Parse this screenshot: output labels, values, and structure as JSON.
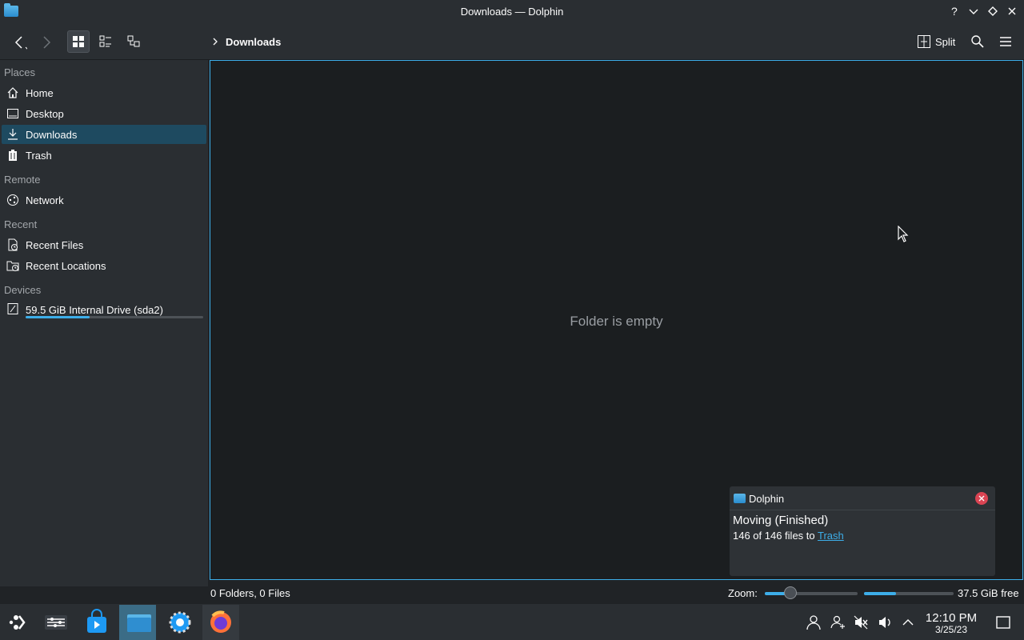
{
  "window": {
    "title": "Downloads — Dolphin"
  },
  "toolbar": {
    "breadcrumb": "Downloads",
    "split_label": "Split"
  },
  "sidebar": {
    "sections": {
      "places": "Places",
      "remote": "Remote",
      "recent": "Recent",
      "devices": "Devices"
    },
    "items": {
      "home": "Home",
      "desktop": "Desktop",
      "downloads": "Downloads",
      "trash": "Trash",
      "network": "Network",
      "recent_files": "Recent Files",
      "recent_locations": "Recent Locations",
      "drive": "59.5 GiB Internal Drive (sda2)"
    },
    "drive_usage_fraction": 0.36
  },
  "main": {
    "empty_text": "Folder is empty"
  },
  "statusbar": {
    "summary": "0 Folders, 0 Files",
    "zoom_label": "Zoom:",
    "free_space": "37.5 GiB free"
  },
  "notification": {
    "app": "Dolphin",
    "title": "Moving (Finished)",
    "body_prefix": "146 of 146 files to ",
    "link": "Trash"
  },
  "clock": {
    "time": "12:10 PM",
    "date": "3/25/23"
  },
  "colors": {
    "accent": "#3daee9",
    "selection": "#1e4a60",
    "close": "#da4453"
  },
  "icons": [
    "application-launcher-icon",
    "mixer-icon",
    "store-icon",
    "folder-icon",
    "settings-icon",
    "firefox-icon",
    "user-icon",
    "user-switch-icon",
    "mute-icon",
    "volume-icon",
    "chevron-up-icon",
    "show-desktop-icon"
  ]
}
